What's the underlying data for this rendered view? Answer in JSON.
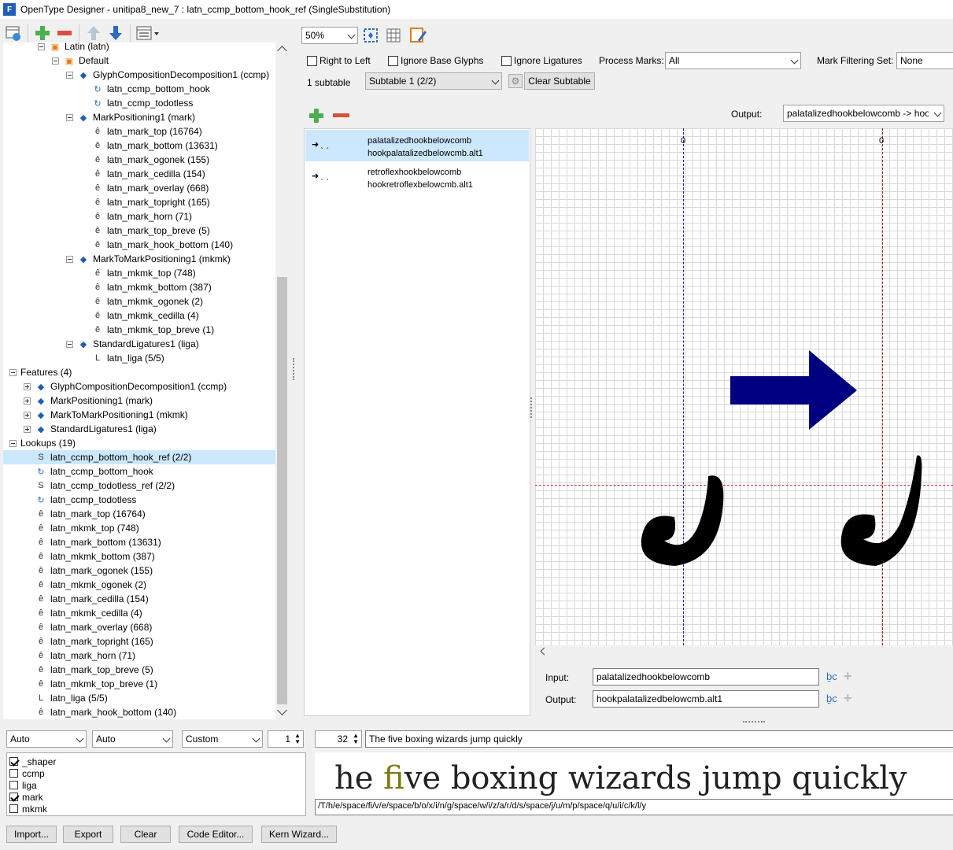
{
  "window": {
    "title": "OpenType Designer - unitipa8_new_7 : latn_ccmp_bottom_hook_ref (SingleSubstitution)"
  },
  "left_tree": [
    {
      "level": 2,
      "icon": "script-icon",
      "label": "Latin (latn)",
      "exp": "minus"
    },
    {
      "level": 3,
      "icon": "language-icon",
      "label": "Default",
      "exp": "minus"
    },
    {
      "level": 4,
      "icon": "feature-icon",
      "label": "GlyphCompositionDecomposition1 (ccmp)",
      "exp": "minus"
    },
    {
      "level": 5,
      "icon": "lookup-chain-icon",
      "label": "latn_ccmp_bottom_hook"
    },
    {
      "level": 5,
      "icon": "lookup-chain-icon",
      "label": "latn_ccmp_todotless"
    },
    {
      "level": 4,
      "icon": "feature-icon",
      "label": "MarkPositioning1 (mark)",
      "exp": "minus"
    },
    {
      "level": 5,
      "icon": "mark-lookup-icon",
      "label": "latn_mark_top (16764)"
    },
    {
      "level": 5,
      "icon": "mark-lookup-icon",
      "label": "latn_mark_bottom (13631)"
    },
    {
      "level": 5,
      "icon": "mark-lookup-icon",
      "label": "latn_mark_ogonek (155)"
    },
    {
      "level": 5,
      "icon": "mark-lookup-icon",
      "label": "latn_mark_cedilla (154)"
    },
    {
      "level": 5,
      "icon": "mark-lookup-icon",
      "label": "latn_mark_overlay (668)"
    },
    {
      "level": 5,
      "icon": "mark-lookup-icon",
      "label": "latn_mark_topright (165)"
    },
    {
      "level": 5,
      "icon": "mark-lookup-icon",
      "label": "latn_mark_horn (71)"
    },
    {
      "level": 5,
      "icon": "mark-lookup-icon",
      "label": "latn_mark_top_breve (5)"
    },
    {
      "level": 5,
      "icon": "mark-lookup-icon",
      "label": "latn_mark_hook_bottom (140)"
    },
    {
      "level": 4,
      "icon": "feature-icon",
      "label": "MarkToMarkPositioning1 (mkmk)",
      "exp": "minus"
    },
    {
      "level": 5,
      "icon": "mkmk-lookup-icon",
      "label": "latn_mkmk_top (748)"
    },
    {
      "level": 5,
      "icon": "mkmk-lookup-icon",
      "label": "latn_mkmk_bottom (387)"
    },
    {
      "level": 5,
      "icon": "mkmk-lookup-icon",
      "label": "latn_mkmk_ogonek (2)"
    },
    {
      "level": 5,
      "icon": "mkmk-lookup-icon",
      "label": "latn_mkmk_cedilla (4)"
    },
    {
      "level": 5,
      "icon": "mkmk-lookup-icon",
      "label": "latn_mkmk_top_breve (1)"
    },
    {
      "level": 4,
      "icon": "feature-icon",
      "label": "StandardLigatures1 (liga)",
      "exp": "minus"
    },
    {
      "level": 5,
      "icon": "ligature-lookup-icon",
      "label": "latn_liga (5/5)"
    },
    {
      "level": 0,
      "icon": "",
      "label": "Features (4)",
      "exp": "minus"
    },
    {
      "level": 1,
      "icon": "feature-icon",
      "label": "GlyphCompositionDecomposition1 (ccmp)",
      "exp": "plus"
    },
    {
      "level": 1,
      "icon": "feature-icon",
      "label": "MarkPositioning1 (mark)",
      "exp": "plus"
    },
    {
      "level": 1,
      "icon": "feature-icon",
      "label": "MarkToMarkPositioning1 (mkmk)",
      "exp": "plus"
    },
    {
      "level": 1,
      "icon": "feature-icon",
      "label": "StandardLigatures1 (liga)",
      "exp": "plus"
    },
    {
      "level": 0,
      "icon": "",
      "label": "Lookups (19)",
      "exp": "minus"
    },
    {
      "level": 1,
      "icon": "single-sub-icon",
      "label": "latn_ccmp_bottom_hook_ref (2/2)",
      "selected": true
    },
    {
      "level": 1,
      "icon": "lookup-chain-icon",
      "label": "latn_ccmp_bottom_hook"
    },
    {
      "level": 1,
      "icon": "single-sub-icon",
      "label": "latn_ccmp_todotless_ref (2/2)"
    },
    {
      "level": 1,
      "icon": "lookup-chain-icon",
      "label": "latn_ccmp_todotless"
    },
    {
      "level": 1,
      "icon": "mark-lookup-icon",
      "label": "latn_mark_top (16764)"
    },
    {
      "level": 1,
      "icon": "mkmk-lookup-icon",
      "label": "latn_mkmk_top (748)"
    },
    {
      "level": 1,
      "icon": "mark-lookup-icon",
      "label": "latn_mark_bottom (13631)"
    },
    {
      "level": 1,
      "icon": "mkmk-lookup-icon",
      "label": "latn_mkmk_bottom (387)"
    },
    {
      "level": 1,
      "icon": "mark-lookup-icon",
      "label": "latn_mark_ogonek (155)"
    },
    {
      "level": 1,
      "icon": "mkmk-lookup-icon",
      "label": "latn_mkmk_ogonek (2)"
    },
    {
      "level": 1,
      "icon": "mark-lookup-icon",
      "label": "latn_mark_cedilla (154)"
    },
    {
      "level": 1,
      "icon": "mkmk-lookup-icon",
      "label": "latn_mkmk_cedilla (4)"
    },
    {
      "level": 1,
      "icon": "mark-lookup-icon",
      "label": "latn_mark_overlay (668)"
    },
    {
      "level": 1,
      "icon": "mark-lookup-icon",
      "label": "latn_mark_topright (165)"
    },
    {
      "level": 1,
      "icon": "mark-lookup-icon",
      "label": "latn_mark_horn (71)"
    },
    {
      "level": 1,
      "icon": "mark-lookup-icon",
      "label": "latn_mark_top_breve (5)"
    },
    {
      "level": 1,
      "icon": "mkmk-lookup-icon",
      "label": "latn_mkmk_top_breve (1)"
    },
    {
      "level": 1,
      "icon": "ligature-lookup-icon",
      "label": "latn_liga (5/5)"
    },
    {
      "level": 1,
      "icon": "mark-lookup-icon",
      "label": "latn_mark_hook_bottom (140)"
    }
  ],
  "toolbar": {
    "zoom": "50%"
  },
  "options": {
    "right_to_left": "Right to Left",
    "ignore_base": "Ignore Base Glyphs",
    "ignore_ligatures": "Ignore Ligatures",
    "process_marks_label": "Process Marks:",
    "process_marks_value": "All",
    "mark_filtering_label": "Mark Filtering Set:",
    "mark_filtering_value": "None",
    "subtable_count": "1 subtable",
    "subtable_value": "Subtable 1 (2/2)",
    "clear_subtable": "Clear Subtable"
  },
  "output_select": {
    "label": "Output:",
    "value": "palatalizedhookbelowcomb -> hoo"
  },
  "subst_list": [
    {
      "input": "palatalizedhookbelowcomb",
      "output": "hookpalatalizedbelowcmb.alt1",
      "selected": true
    },
    {
      "input": "retroflexhookbelowcomb",
      "output": "hookretroflexbelowcmb.alt1",
      "selected": false
    }
  ],
  "preview": {
    "origin_left": "0",
    "origin_right": "0"
  },
  "io": {
    "input_label": "Input:",
    "input_value": "palatalizedhookbelowcomb",
    "output_label": "Output:",
    "output_value": "hookpalatalizedbelowcmb.alt1"
  },
  "bottom": {
    "dir": "Auto",
    "script": "Auto",
    "lang": "Custom",
    "num": "1",
    "size": "32",
    "sample": "The five boxing wizards jump quickly",
    "features": [
      {
        "label": "_shaper",
        "checked": true
      },
      {
        "label": "ccmp",
        "checked": false
      },
      {
        "label": "liga",
        "checked": false
      },
      {
        "label": "mark",
        "checked": true
      },
      {
        "label": "mkmk",
        "checked": false
      }
    ],
    "render_before": "he ",
    "render_fi": "fi",
    "render_after": "ve boxing wizards jump quickly",
    "glyph_run": "/T/h/e/space/fi/v/e/space/b/o/x/i/n/g/space/w/i/z/a/r/d/s/space/j/u/m/p/space/q/u/i/c/k/l/y"
  },
  "buttons": {
    "import": "Import...",
    "export": "Export",
    "clear": "Clear",
    "code_editor": "Code Editor...",
    "kern_wizard": "Kern Wizard..."
  },
  "colors": {
    "accent_green": "#4caf50",
    "accent_red": "#d9503f",
    "arrow_blue": "#000080",
    "selection": "#cce8ff"
  }
}
